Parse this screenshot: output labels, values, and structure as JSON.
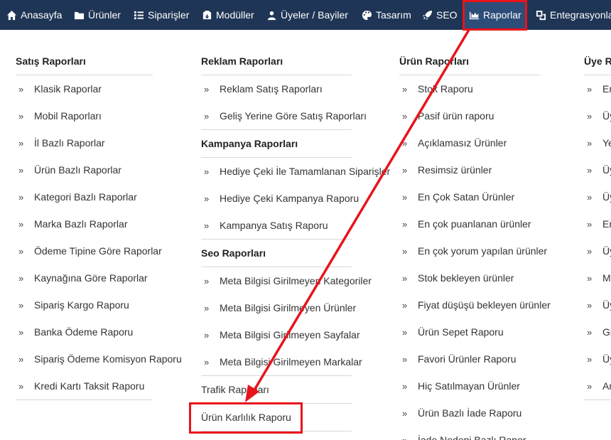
{
  "nav": [
    {
      "label": "Anasayfa",
      "icon": "home-icon"
    },
    {
      "label": "Ürünler",
      "icon": "folder-icon"
    },
    {
      "label": "Siparişler",
      "icon": "list-icon"
    },
    {
      "label": "Modüller",
      "icon": "box-icon"
    },
    {
      "label": "Üyeler / Bayiler",
      "icon": "users-icon"
    },
    {
      "label": "Tasarım",
      "icon": "palette-icon"
    },
    {
      "label": "SEO",
      "icon": "rocket-icon"
    },
    {
      "label": "Raporlar",
      "icon": "crown-chart-icon"
    },
    {
      "label": "Entegrasyonla",
      "icon": "integration-icon"
    }
  ],
  "col1": {
    "title": "Satış Raporları",
    "items": [
      "Klasik Raporlar",
      "Mobil Raporları",
      "İl Bazlı Raporlar",
      "Ürün Bazlı Raporlar",
      "Kategori Bazlı Raporlar",
      "Marka Bazlı Raporlar",
      "Ödeme Tipine Göre Raporlar",
      "Kaynağına Göre Raporlar",
      "Sipariş Kargo Raporu",
      "Banka Ödeme Raporu",
      "Sipariş Ödeme Komisyon Raporu",
      "Kredi Kartı Taksit Raporu"
    ]
  },
  "col2": {
    "reklam_title": "Reklam Raporları",
    "reklam_items": [
      "Reklam Satış Raporları",
      "Geliş Yerine Göre Satış Raporları"
    ],
    "kampanya_title": "Kampanya Raporları",
    "kampanya_items": [
      "Hediye Çeki İle Tamamlanan Siparişler",
      "Hediye Çeki Kampanya Raporu",
      "Kampanya Satış Raporu"
    ],
    "seo_title": "Seo Raporları",
    "seo_items": [
      "Meta Bilgisi Girilmeyen Kategoriler",
      "Meta Bilgisi Girilmeyen Ürünler",
      "Meta Bilgisi Girilmeyen Sayfalar",
      "Meta Bilgisi Girilmeyen Markalar"
    ],
    "trafik": "Trafik Raporları",
    "karlilik": "Ürün Karlılık Raporu"
  },
  "col3": {
    "title": "Ürün Raporları",
    "items": [
      "Stok Raporu",
      "Pasif ürün raporu",
      "Açıklamasız Ürünler",
      "Resimsiz ürünler",
      "En Çok Satan Ürünler",
      "En çok puanlanan ürünler",
      "En çok yorum yapılan ürünler",
      "Stok bekleyen ürünler",
      "Fiyat düşüşü bekleyen ürünler",
      "Ürün Sepet Raporu",
      "Favori Ürünler Raporu",
      "Hiç Satılmayan Ürünler",
      "Ürün Bazlı İade Raporu",
      "İade Nedeni Bazlı Rapor"
    ]
  },
  "col4": {
    "title": "Üye R",
    "items": [
      "En",
      "Üy",
      "Ye",
      "Üy",
      "Üy",
      "En",
      "Üy",
      "Mü",
      "Üy",
      "Gi",
      "Üy",
      "Ar"
    ]
  },
  "annotation_color": "#e8141b"
}
